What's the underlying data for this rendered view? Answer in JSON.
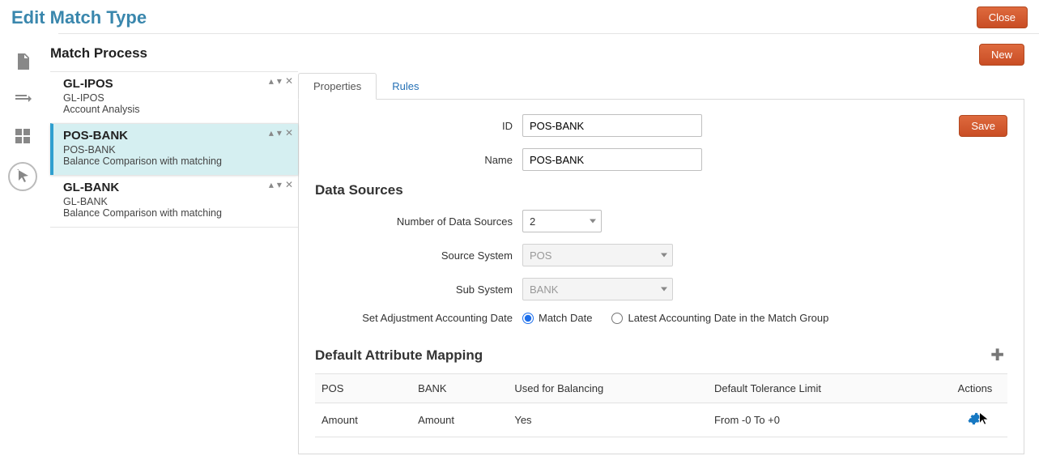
{
  "header": {
    "title": "Edit Match Type",
    "close": "Close"
  },
  "sidebar": {
    "title": "Match Process",
    "items": [
      {
        "title": "GL-IPOS",
        "sub": "GL-IPOS",
        "desc": "Account Analysis",
        "selected": false
      },
      {
        "title": "POS-BANK",
        "sub": "POS-BANK",
        "desc": "Balance Comparison with matching",
        "selected": true
      },
      {
        "title": "GL-BANK",
        "sub": "GL-BANK",
        "desc": "Balance Comparison with matching",
        "selected": false
      }
    ]
  },
  "buttons": {
    "new": "New",
    "save": "Save"
  },
  "tabs": {
    "properties": "Properties",
    "rules": "Rules"
  },
  "form": {
    "id_label": "ID",
    "id_value": "POS-BANK",
    "name_label": "Name",
    "name_value": "POS-BANK"
  },
  "data_sources": {
    "title": "Data Sources",
    "num_label": "Number of Data Sources",
    "num_value": "2",
    "source_label": "Source System",
    "source_value": "POS",
    "sub_label": "Sub System",
    "sub_value": "BANK",
    "adj_label": "Set Adjustment Accounting Date",
    "radio_match": "Match Date",
    "radio_latest": "Latest Accounting Date in the Match Group"
  },
  "dam": {
    "title": "Default Attribute Mapping",
    "columns": [
      "POS",
      "BANK",
      "Used for Balancing",
      "Default Tolerance Limit",
      "Actions"
    ],
    "rows": [
      {
        "pos": "Amount",
        "bank": "Amount",
        "balancing": "Yes",
        "tol": "From -0 To +0"
      }
    ]
  }
}
